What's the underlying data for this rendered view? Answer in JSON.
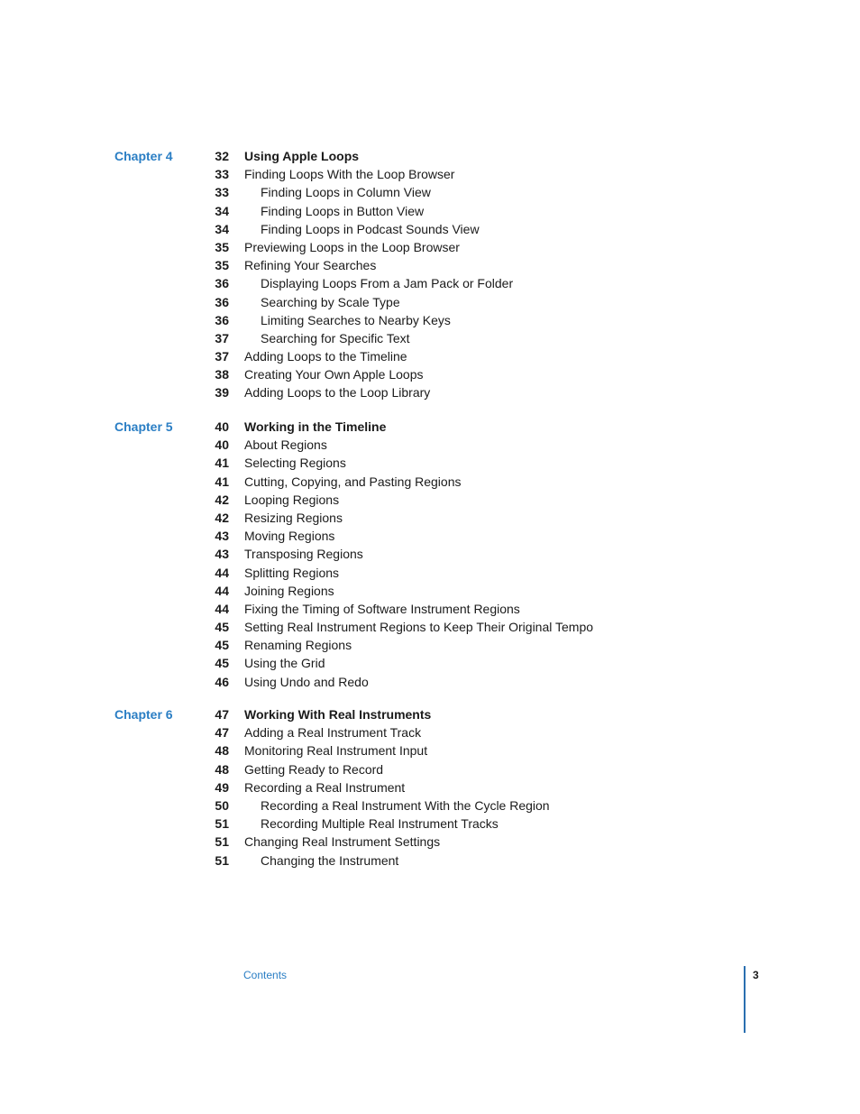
{
  "chapters": [
    {
      "label": "Chapter 4",
      "entries": [
        {
          "page": "32",
          "title": "Using Apple Loops",
          "level": "head"
        },
        {
          "page": "33",
          "title": "Finding Loops With the Loop Browser",
          "level": "main"
        },
        {
          "page": "33",
          "title": "Finding Loops in Column View",
          "level": "sub"
        },
        {
          "page": "34",
          "title": "Finding Loops in Button View",
          "level": "sub"
        },
        {
          "page": "34",
          "title": "Finding Loops in Podcast Sounds View",
          "level": "sub"
        },
        {
          "page": "35",
          "title": "Previewing Loops in the Loop Browser",
          "level": "main"
        },
        {
          "page": "35",
          "title": "Refining Your Searches",
          "level": "main"
        },
        {
          "page": "36",
          "title": "Displaying Loops From a Jam Pack or Folder",
          "level": "sub"
        },
        {
          "page": "36",
          "title": "Searching by Scale Type",
          "level": "sub"
        },
        {
          "page": "36",
          "title": "Limiting Searches to Nearby Keys",
          "level": "sub"
        },
        {
          "page": "37",
          "title": "Searching for Specific Text",
          "level": "sub"
        },
        {
          "page": "37",
          "title": "Adding Loops to the Timeline",
          "level": "main"
        },
        {
          "page": "38",
          "title": "Creating Your Own Apple Loops",
          "level": "main"
        },
        {
          "page": "39",
          "title": "Adding Loops to the Loop Library",
          "level": "main"
        }
      ]
    },
    {
      "label": "Chapter 5",
      "entries": [
        {
          "page": "40",
          "title": "Working in the Timeline",
          "level": "head"
        },
        {
          "page": "40",
          "title": "About Regions",
          "level": "main"
        },
        {
          "page": "41",
          "title": "Selecting Regions",
          "level": "main"
        },
        {
          "page": "41",
          "title": "Cutting, Copying, and Pasting Regions",
          "level": "main"
        },
        {
          "page": "42",
          "title": "Looping Regions",
          "level": "main"
        },
        {
          "page": "42",
          "title": "Resizing Regions",
          "level": "main"
        },
        {
          "page": "43",
          "title": "Moving Regions",
          "level": "main"
        },
        {
          "page": "43",
          "title": "Transposing Regions",
          "level": "main"
        },
        {
          "page": "44",
          "title": "Splitting Regions",
          "level": "main"
        },
        {
          "page": "44",
          "title": "Joining Regions",
          "level": "main"
        },
        {
          "page": "44",
          "title": "Fixing the Timing of Software Instrument Regions",
          "level": "main"
        },
        {
          "page": "45",
          "title": "Setting Real Instrument Regions to Keep Their Original Tempo",
          "level": "main"
        },
        {
          "page": "45",
          "title": "Renaming Regions",
          "level": "main"
        },
        {
          "page": "45",
          "title": "Using the Grid",
          "level": "main"
        },
        {
          "page": "46",
          "title": "Using Undo and Redo",
          "level": "main"
        }
      ]
    },
    {
      "label": "Chapter 6",
      "entries": [
        {
          "page": "47",
          "title": "Working With Real Instruments",
          "level": "head"
        },
        {
          "page": "47",
          "title": "Adding a Real Instrument Track",
          "level": "main"
        },
        {
          "page": "48",
          "title": "Monitoring Real Instrument Input",
          "level": "main"
        },
        {
          "page": "48",
          "title": "Getting Ready to Record",
          "level": "main"
        },
        {
          "page": "49",
          "title": "Recording a Real Instrument",
          "level": "main"
        },
        {
          "page": "50",
          "title": "Recording a Real Instrument With the Cycle Region",
          "level": "sub"
        },
        {
          "page": "51",
          "title": "Recording Multiple Real Instrument Tracks",
          "level": "sub"
        },
        {
          "page": "51",
          "title": "Changing Real Instrument Settings",
          "level": "main"
        },
        {
          "page": "51",
          "title": "Changing the Instrument",
          "level": "sub"
        }
      ]
    }
  ],
  "footer": {
    "section_label": "Contents",
    "page_number": "3"
  },
  "colors": {
    "accent": "#2a7ec4",
    "text": "#1a1a1a"
  }
}
